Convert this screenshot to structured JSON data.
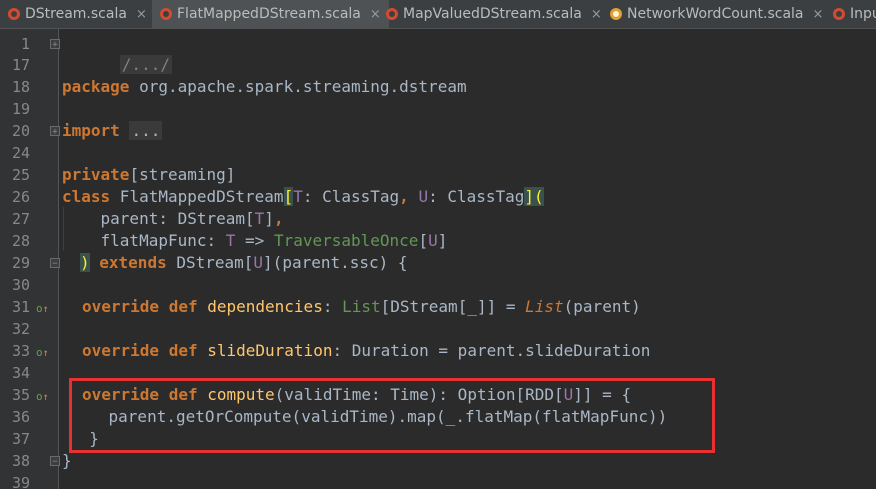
{
  "tabs": [
    {
      "label": "DStream.scala",
      "close": "×",
      "icon": "scala-class-icon",
      "active": false
    },
    {
      "label": "FlatMappedDStream.scala",
      "close": "×",
      "icon": "scala-class-icon",
      "active": true
    },
    {
      "label": "MapValuedDStream.scala",
      "close": "×",
      "icon": "scala-class-icon",
      "active": false
    },
    {
      "label": "NetworkWordCount.scala",
      "close": "×",
      "icon": "scala-object-icon",
      "active": false
    },
    {
      "label": "Inpu",
      "icon": "scala-class-icon",
      "active": false
    }
  ],
  "line_numbers": [
    "1",
    "17",
    "18",
    "19",
    "20",
    "24",
    "25",
    "26",
    "27",
    "28",
    "29",
    "30",
    "31",
    "32",
    "33",
    "34",
    "35",
    "36",
    "37",
    "38",
    "39"
  ],
  "code": {
    "l1": "/.../",
    "l18_kw": "package",
    "l18_rest": " org.apache.spark.streaming.dstream",
    "l20_kw": "import",
    "l20_rest": "...",
    "l25_kw": "private",
    "l25_rest": "[streaming]",
    "l26_kw": "class",
    "l26_name": " FlatMappedDStream",
    "l26_b1": "[",
    "l26_T": "T",
    "l26_mid": ": ClassTag",
    "l26_comma": ",",
    "l26_U": " U",
    "l26_mid2": ": ClassTag",
    "l26_b2": "]",
    "l26_p": "(",
    "l27_a": "    parent: DStream[",
    "l27_T": "T",
    "l27_b": "]",
    "l27_comma": ",",
    "l28_a": "    flatMapFunc: ",
    "l28_T": "T",
    "l28_b": " => ",
    "l28_tr": "TraversableOnce",
    "l28_c": "[",
    "l28_U": "U",
    "l28_d": "]",
    "l29_p": ")",
    "l29_kw": " extends",
    "l29_a": " DStream[",
    "l29_U": "U",
    "l29_b": "](parent.ssc) {",
    "l31_kw": "override def",
    "l31_fn": " dependencies",
    "l31_a": ": ",
    "l31_list": "List",
    "l31_b": "[DStream[_]] = ",
    "l31_list2": "List",
    "l31_c": "(parent)",
    "l33_kw": "override def",
    "l33_fn": " slideDuration",
    "l33_a": ": Duration = parent.slideDuration",
    "l35_kw": "override def",
    "l35_fn": " compute",
    "l35_a": "(validTime: Time): Option[RDD[",
    "l35_U": "U",
    "l35_b": "]] = {",
    "l36": "    parent.getOrCompute(validTime).map(_.flatMap(flatMapFunc))",
    "l37": "  }",
    "l38": "}"
  },
  "gutter_icons": {
    "override_marker": "o",
    "override_arrow": "↑",
    "fold_plus": "+",
    "fold_minus": "−"
  },
  "colors": {
    "background": "#2b2b2b",
    "keyword": "#cc7832",
    "function": "#ffc66d",
    "type_param": "#9876aa",
    "trait": "#629755",
    "text": "#a9b7c6",
    "highlight_border": "#e83030"
  }
}
